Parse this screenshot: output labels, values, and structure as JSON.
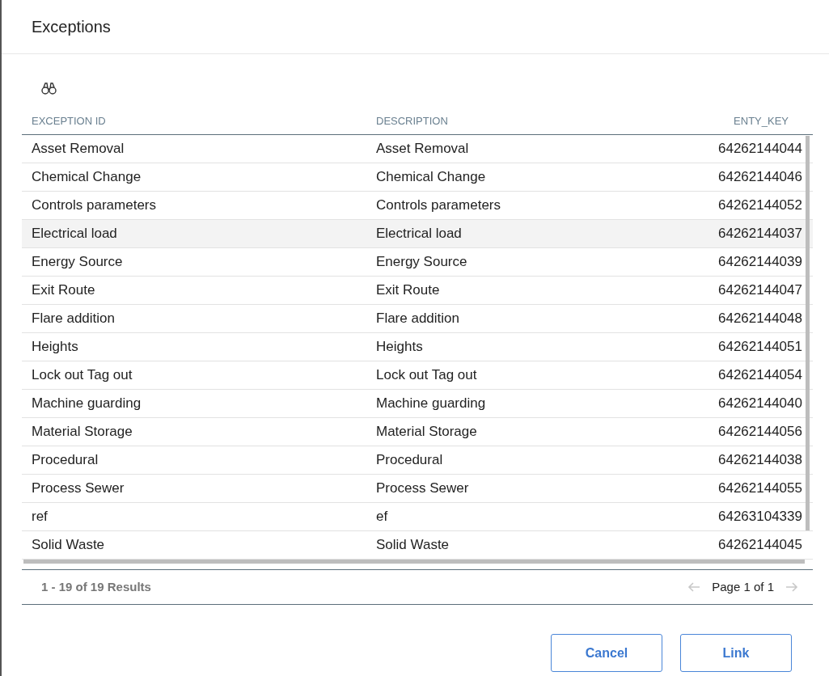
{
  "dialog": {
    "title": "Exceptions"
  },
  "table": {
    "columns": [
      "EXCEPTION ID",
      "DESCRIPTION",
      "ENTY_KEY"
    ],
    "rows": [
      {
        "cells": [
          "Asset Removal",
          "Asset Removal",
          "64262144044"
        ],
        "highlighted": false
      },
      {
        "cells": [
          "Chemical Change",
          "Chemical Change",
          "64262144046"
        ],
        "highlighted": false
      },
      {
        "cells": [
          "Controls parameters",
          "Controls parameters",
          "64262144052"
        ],
        "highlighted": false
      },
      {
        "cells": [
          "Electrical load",
          "Electrical load",
          "64262144037"
        ],
        "highlighted": true
      },
      {
        "cells": [
          "Energy Source",
          "Energy Source",
          "64262144039"
        ],
        "highlighted": false
      },
      {
        "cells": [
          "Exit Route",
          "Exit Route",
          "64262144047"
        ],
        "highlighted": false
      },
      {
        "cells": [
          "Flare addition",
          "Flare addition",
          "64262144048"
        ],
        "highlighted": false
      },
      {
        "cells": [
          "Heights",
          "Heights",
          "64262144051"
        ],
        "highlighted": false
      },
      {
        "cells": [
          "Lock out Tag out",
          "Lock out Tag out",
          "64262144054"
        ],
        "highlighted": false
      },
      {
        "cells": [
          "Machine guarding",
          "Machine guarding",
          "64262144040"
        ],
        "highlighted": false
      },
      {
        "cells": [
          "Material Storage",
          "Material Storage",
          "64262144056"
        ],
        "highlighted": false
      },
      {
        "cells": [
          "Procedural",
          "Procedural",
          "64262144038"
        ],
        "highlighted": false
      },
      {
        "cells": [
          "Process Sewer",
          "Process Sewer",
          "64262144055"
        ],
        "highlighted": false
      },
      {
        "cells": [
          "ref",
          "ef",
          "64263104339"
        ],
        "highlighted": false
      },
      {
        "cells": [
          "Solid Waste",
          "Solid Waste",
          "64262144045"
        ],
        "highlighted": false
      }
    ]
  },
  "pager": {
    "results": "1 - 19 of 19 Results",
    "page": "Page 1 of 1"
  },
  "buttons": [
    "Cancel",
    "Link"
  ]
}
